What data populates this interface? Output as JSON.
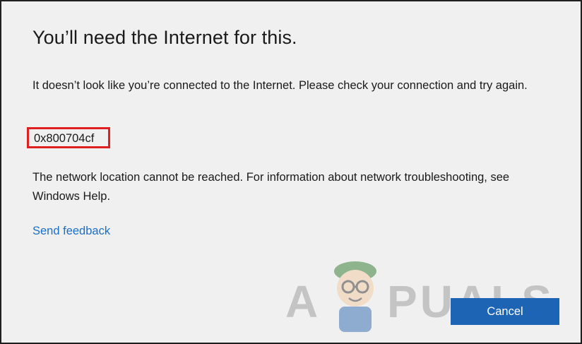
{
  "dialog": {
    "title": "You’ll need the Internet for this.",
    "message": "It doesn’t look like you’re connected to the Internet. Please check your connection and try again.",
    "error_code": "0x800704cf",
    "detail": "The network location cannot be reached. For information about network troubleshooting, see Windows Help.",
    "feedback_link": "Send feedback",
    "cancel_label": "Cancel"
  },
  "watermark": {
    "logo_text": "APPUALS",
    "letter_a": "A",
    "letters_rest": "PUALS"
  },
  "colors": {
    "background": "#f0f0f0",
    "link": "#1a6fc7",
    "button": "#1e64b4",
    "highlight_box": "#e02020"
  }
}
